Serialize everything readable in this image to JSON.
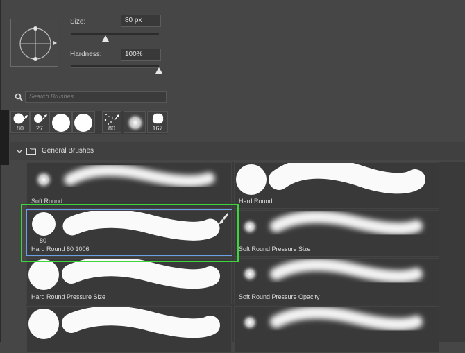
{
  "brush_settings": {
    "size_label": "Size:",
    "size_value": "80 px",
    "size_slider_fraction": 0.39,
    "hardness_label": "Hardness:",
    "hardness_value": "100%",
    "hardness_slider_fraction": 1.0
  },
  "search": {
    "placeholder": "Search Brushes"
  },
  "recent_brushes": [
    {
      "label": "80",
      "icon": "hard-round-brush-icon"
    },
    {
      "label": "27",
      "icon": "hard-round-brush-icon"
    },
    {
      "label": "",
      "icon": "hard-round-brush-icon"
    },
    {
      "label": "",
      "icon": "hard-round-brush-icon"
    },
    {
      "label": "80",
      "icon": "scatter-brush-icon"
    },
    {
      "label": "",
      "icon": "soft-round-brush-icon"
    },
    {
      "label": "167",
      "icon": "textured-brush-icon"
    }
  ],
  "group": {
    "name": "General Brushes",
    "expanded": true
  },
  "brushes": [
    {
      "name": "Soft Round",
      "type": "soft"
    },
    {
      "name": "Hard Round",
      "type": "hard"
    },
    {
      "name": "Hard Round 80 1006",
      "type": "hard",
      "size_label": "80",
      "selected": true
    },
    {
      "name": "Soft Round Pressure Size",
      "type": "soft"
    },
    {
      "name": "Hard Round Pressure Size",
      "type": "hard"
    },
    {
      "name": "Soft Round Pressure Opacity",
      "type": "soft"
    },
    {
      "name": "",
      "type": "hard"
    },
    {
      "name": "",
      "type": "soft"
    }
  ],
  "colors": {
    "panel_bg": "#464646",
    "selection_border": "#6aa0e8",
    "highlight_border": "#3ad63a"
  }
}
